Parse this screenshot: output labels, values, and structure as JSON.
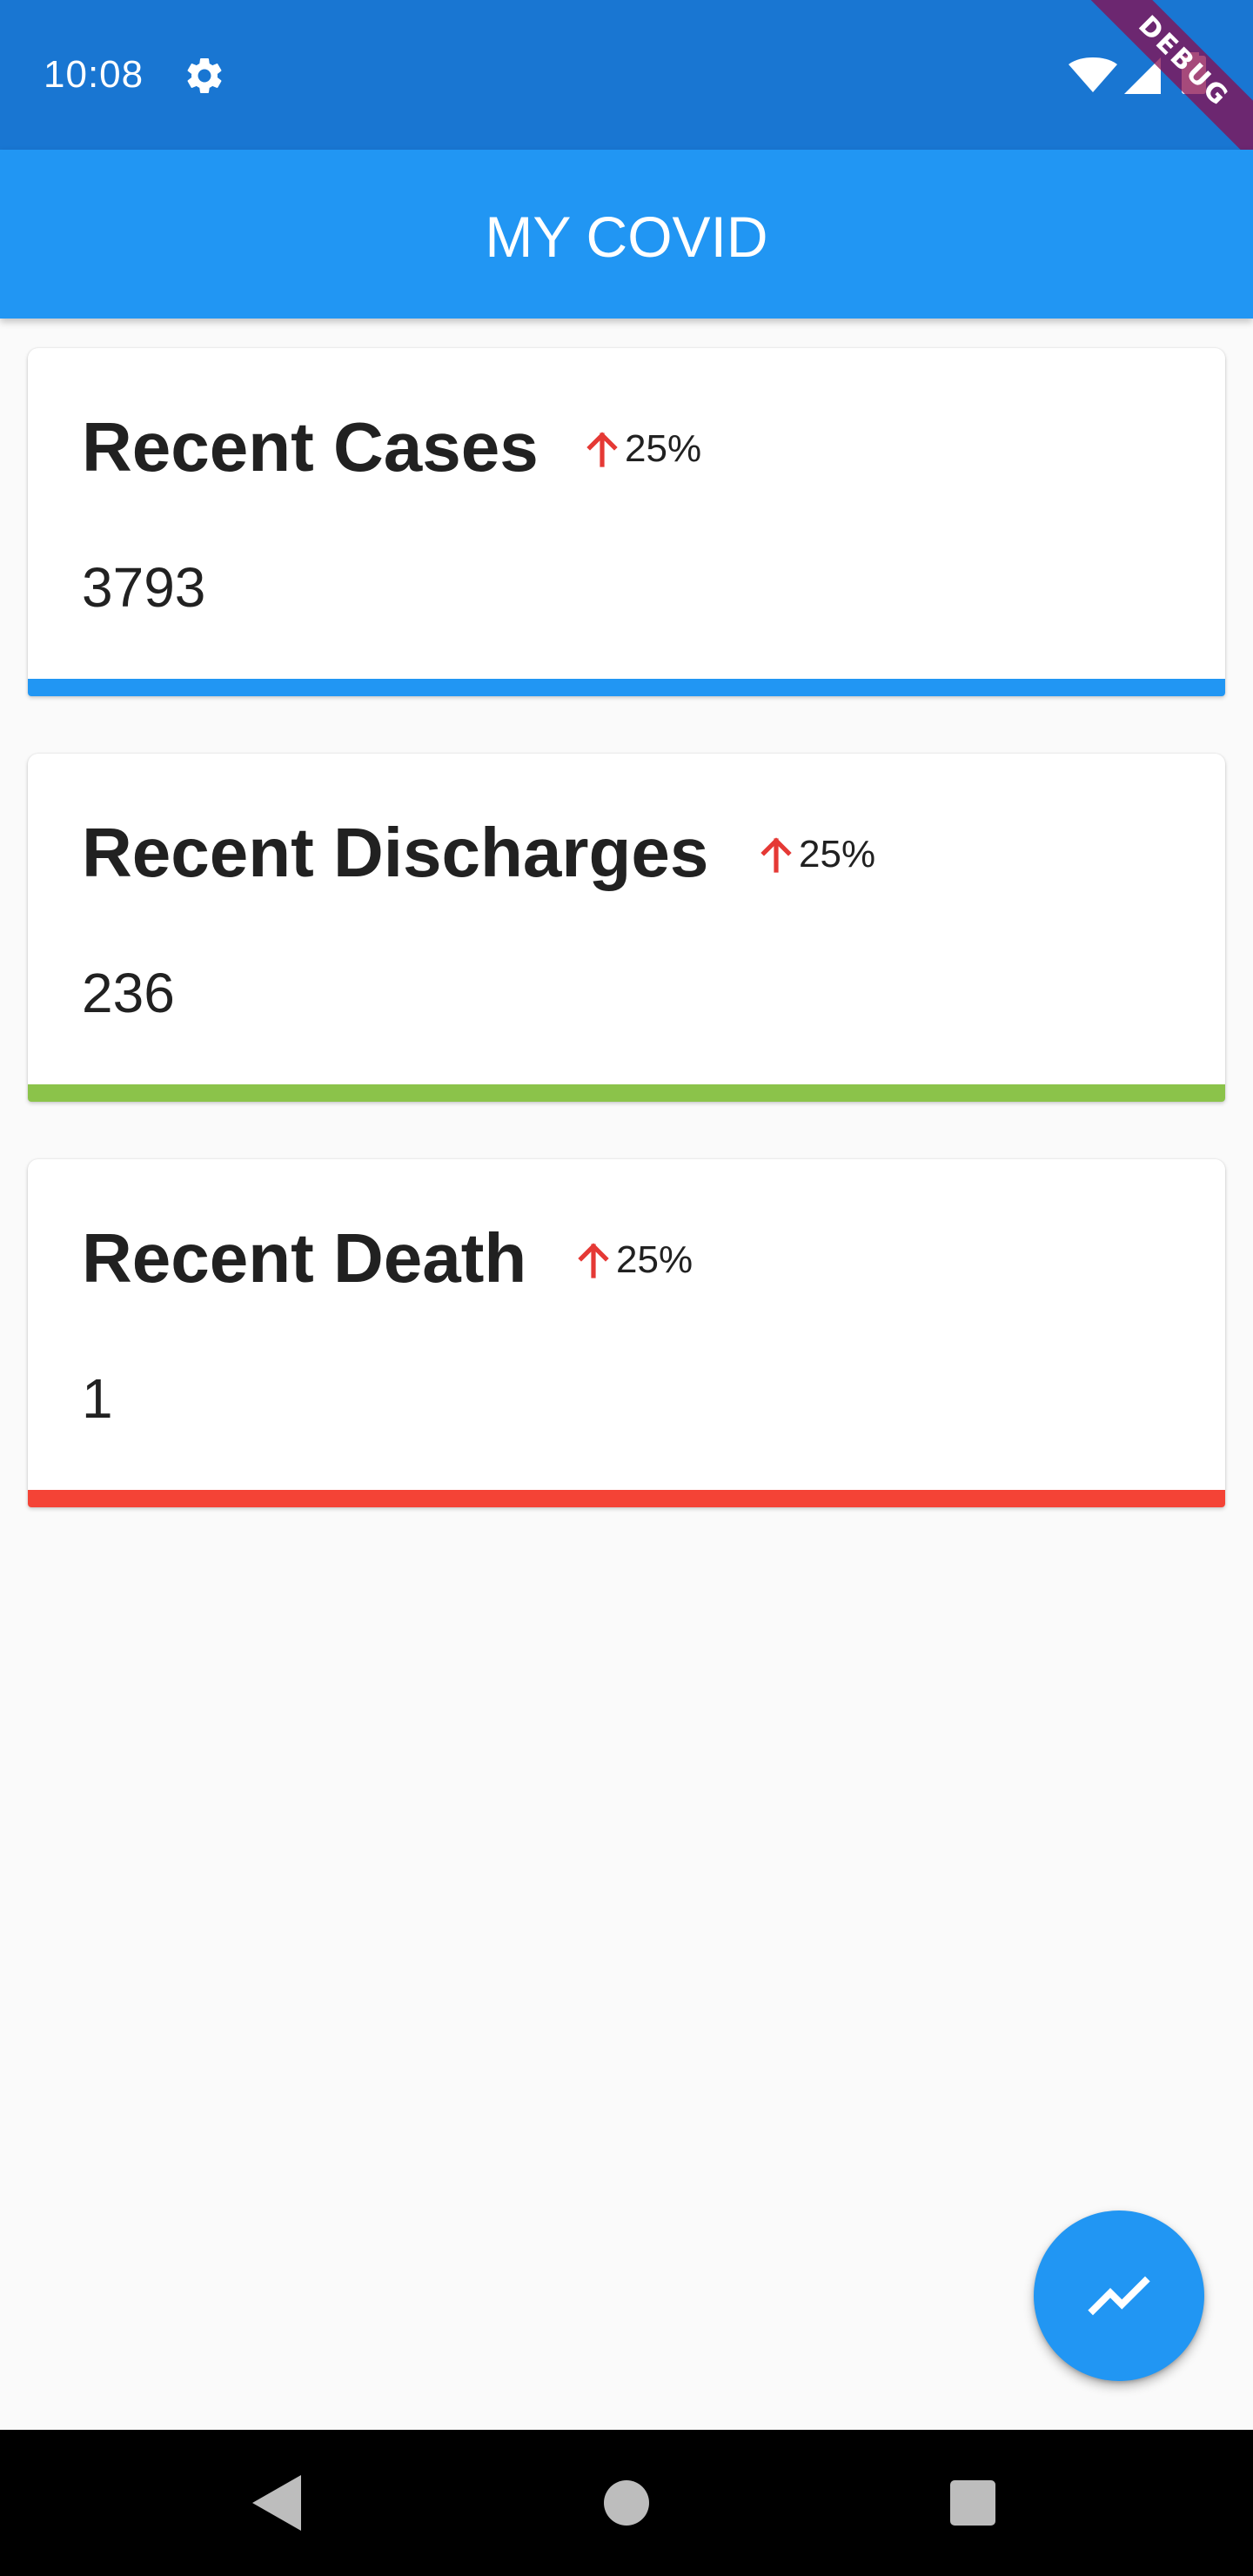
{
  "status_bar": {
    "time": "10:08",
    "icons": [
      "gear-icon",
      "wifi-icon",
      "signal-icon",
      "battery-icon"
    ],
    "debug_banner": "DEBUG"
  },
  "app_bar": {
    "title": "MY COVID",
    "color": "#2196f3"
  },
  "cards": [
    {
      "title": "Recent Cases",
      "trend": "25%",
      "trend_icon": "arrow-up-icon",
      "value": "3793",
      "accent_color": "#2196f3"
    },
    {
      "title": "Recent Discharges",
      "trend": "25%",
      "trend_icon": "arrow-up-icon",
      "value": "236",
      "accent_color": "#8bc34a"
    },
    {
      "title": "Recent Death",
      "trend": "25%",
      "trend_icon": "arrow-up-icon",
      "value": "1",
      "accent_color": "#f44336"
    }
  ],
  "fab": {
    "icon": "trending-up-icon",
    "color": "#2196f3"
  },
  "nav_bar": {
    "buttons": [
      "back-icon",
      "home-icon",
      "recents-icon"
    ]
  },
  "colors": {
    "trend_up": "#e53935",
    "status_bar": "#1976d2",
    "background": "#fafafa"
  }
}
